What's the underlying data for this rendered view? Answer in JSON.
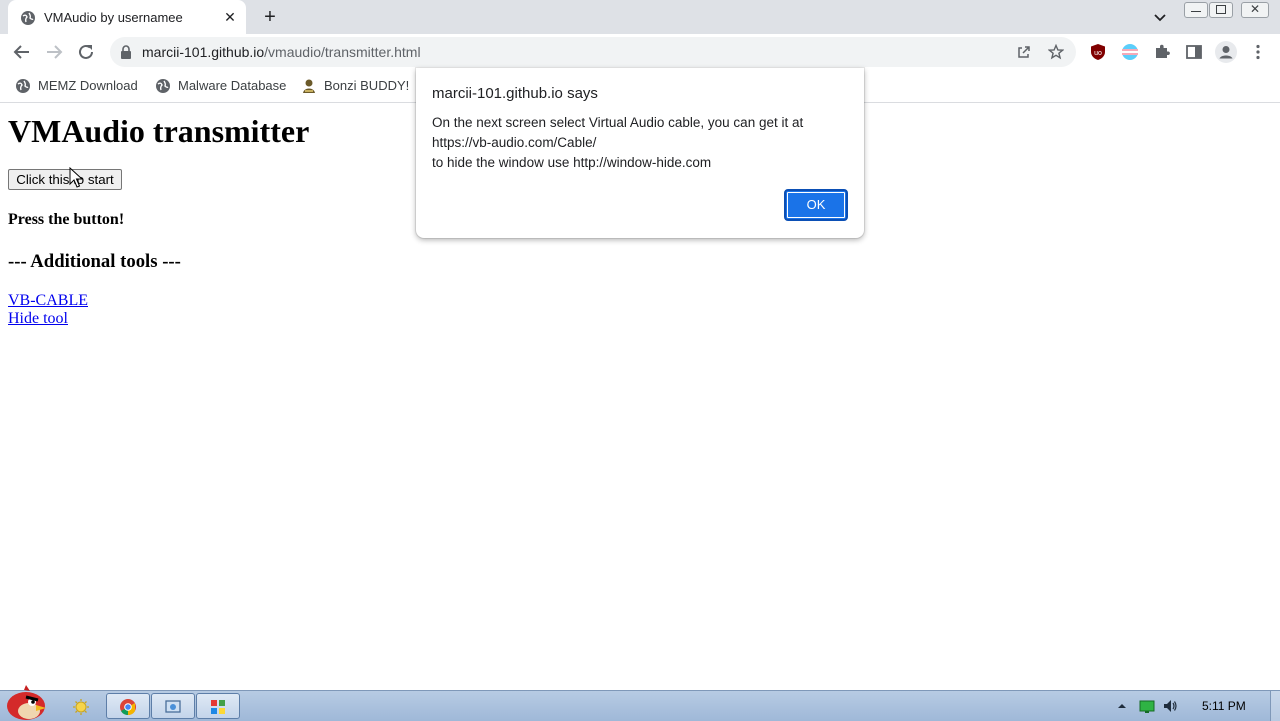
{
  "browser": {
    "tab_title": "VMAudio by usernamee",
    "url_host": "marcii-101.github.io",
    "url_path": "/vmaudio/transmitter.html",
    "bookmarks": [
      {
        "label": "MEMZ Download",
        "icon": "globe-icon"
      },
      {
        "label": "Malware Database",
        "icon": "globe-icon"
      },
      {
        "label": "Bonzi BUDDY!",
        "icon": "bonzi-icon"
      }
    ]
  },
  "page": {
    "heading": "VMAudio transmitter",
    "start_button": "Click this to start",
    "press_text": "Press the button!",
    "tools_heading": "--- Additional tools ---",
    "links": [
      {
        "label": "VB-CABLE"
      },
      {
        "label": "Hide tool"
      }
    ]
  },
  "dialog": {
    "title": "marcii-101.github.io says",
    "lines": [
      "On the next screen select Virtual Audio cable, you can get it at",
      "https://vb-audio.com/Cable/",
      "to hide the window use http://window-hide.com"
    ],
    "ok_label": "OK"
  },
  "taskbar": {
    "clock": "5:11 PM"
  },
  "colors": {
    "accent": "#1a73e8",
    "link": "#0000ee",
    "taskbar": "#b7cbe3"
  }
}
